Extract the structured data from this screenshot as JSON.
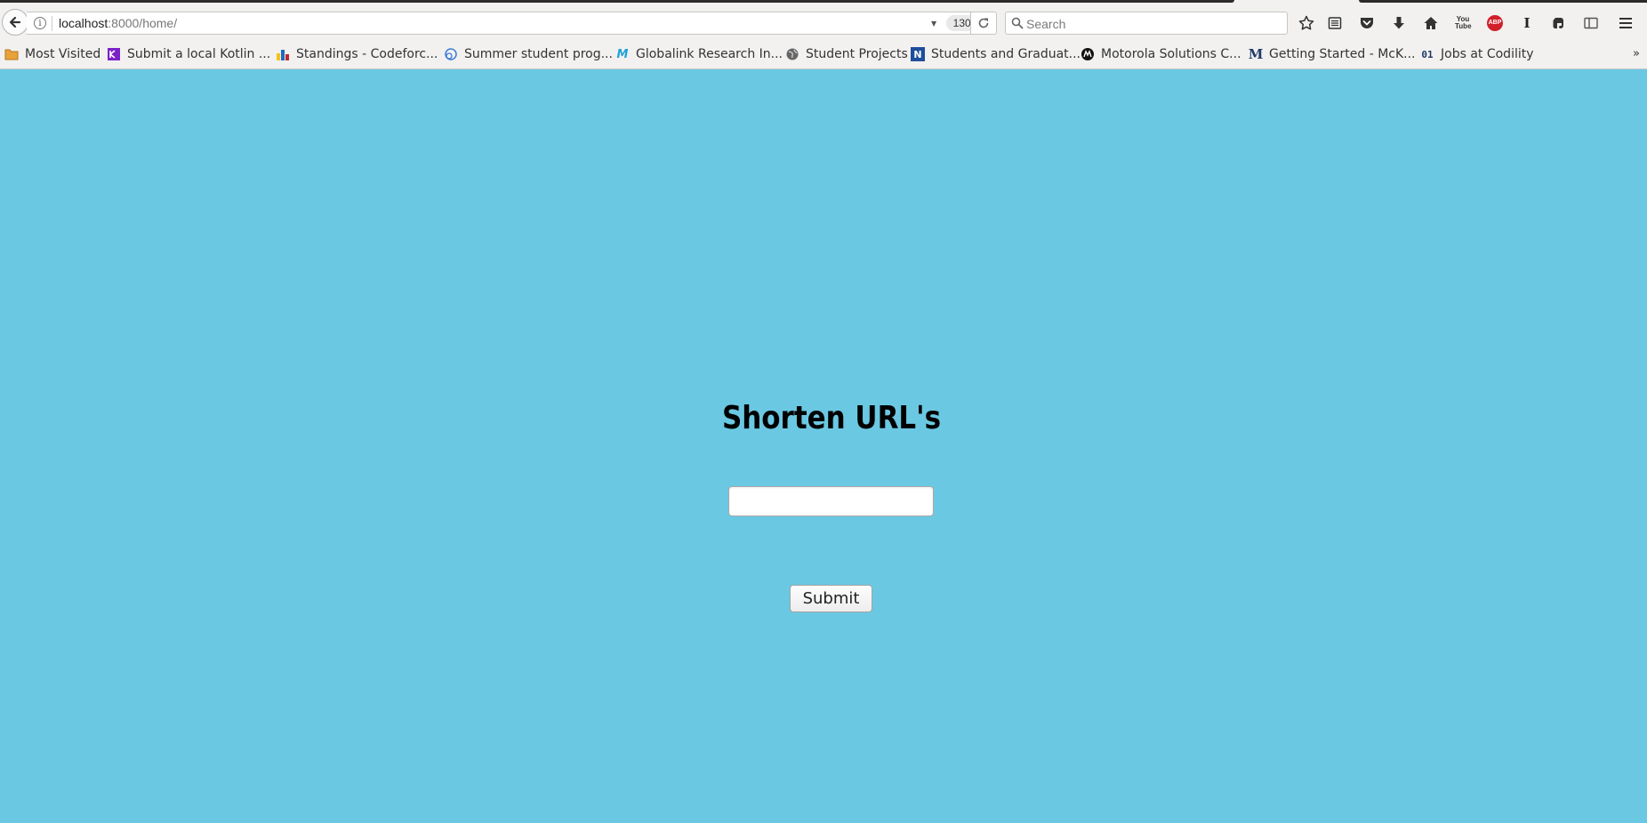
{
  "browser": {
    "url_host": "localhost",
    "url_path": ":8000/home/",
    "zoom": "130%",
    "search_placeholder": "Search",
    "toolbar_icons": [
      "star-icon",
      "reading-list-icon",
      "pocket-icon",
      "download-icon",
      "home-icon",
      "youtube-icon",
      "adblock-icon",
      "i-icon",
      "evernote-icon",
      "sidebar-icon",
      "hamburger-menu-icon"
    ],
    "adblock_label": "ABP",
    "youtube_label": "You Tube",
    "i_label": "I"
  },
  "bookmarks": [
    {
      "label": "Most Visited",
      "icon": "folder-icon"
    },
    {
      "label": "Submit a local Kotlin ...",
      "icon": "kotlin-icon"
    },
    {
      "label": "Standings - Codeforc...",
      "icon": "codeforces-icon"
    },
    {
      "label": "Summer student prog...",
      "icon": "cern-icon"
    },
    {
      "label": "Globalink Research In...",
      "icon": "mitacs-icon",
      "glyph": "M"
    },
    {
      "label": "Student Projects",
      "icon": "globe-icon"
    },
    {
      "label": "Students and Graduat...",
      "icon": "n-logo-icon",
      "glyph": "N"
    },
    {
      "label": "Motorola Solutions C...",
      "icon": "motorola-icon"
    },
    {
      "label": "Getting Started - McK...",
      "icon": "mckinsey-icon",
      "glyph": "M"
    },
    {
      "label": "Jobs at Codility",
      "icon": "codility-icon",
      "glyph": "01"
    }
  ],
  "page": {
    "title": "Shorten URL's",
    "input_value": "",
    "submit_label": "Submit"
  },
  "colors": {
    "page_background": "#6bc8e2",
    "chrome_background": "#f2f1f0"
  }
}
